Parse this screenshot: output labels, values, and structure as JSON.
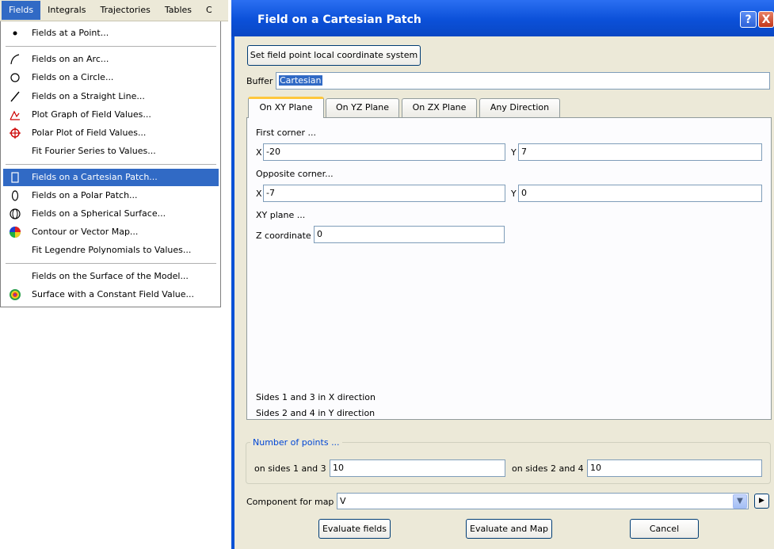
{
  "menubar": {
    "items": [
      "Fields",
      "Integrals",
      "Trajectories",
      "Tables",
      "C"
    ]
  },
  "fields_menu": {
    "items": [
      "Fields at a Point...",
      "Fields on an Arc...",
      "Fields on a Circle...",
      "Fields on a Straight Line...",
      "Plot Graph of Field Values...",
      "Polar Plot of Field Values...",
      "Fit Fourier Series to Values...",
      "Fields on a Cartesian Patch...",
      "Fields on a Polar Patch...",
      "Fields on a Spherical Surface...",
      "Contour or Vector Map...",
      "Fit Legendre Polynomials to Values...",
      "Fields on the Surface of the Model...",
      "Surface with a Constant Field Value..."
    ],
    "highlighted": "Fields on a Cartesian Patch...",
    "icons": [
      "bullet-icon",
      "arc-icon",
      "circle-icon",
      "line-icon",
      "plot-graph-icon",
      "polar-plot-icon",
      "",
      "cartesian-patch-icon",
      "polar-patch-icon",
      "spherical-surface-icon",
      "contour-map-icon",
      "",
      "",
      "constant-surface-icon"
    ]
  },
  "dialog": {
    "title": "Field on a Cartesian Patch",
    "help_button": "?",
    "close_button": "X",
    "set_coord_button": "Set field point local coordinate system",
    "buffer_label": "Buffer",
    "buffer_value": "Cartesian",
    "tabs": [
      "On XY Plane",
      "On YZ Plane",
      "On ZX Plane",
      "Any Direction"
    ],
    "active_tab": "On XY Plane",
    "panel": {
      "first_corner_label": "First corner ...",
      "first_x_label": "X",
      "first_x_value": "-20",
      "first_y_label": "Y",
      "first_y_value": "7",
      "opposite_corner_label": "Opposite corner...",
      "opp_x_label": "X",
      "opp_x_value": "-7",
      "opp_y_label": "Y",
      "opp_y_value": "0",
      "plane_label": "XY plane ...",
      "z_label": "Z coordinate",
      "z_value": "0",
      "note1": "Sides 1 and 3 in X direction",
      "note2": "Sides 2 and 4 in Y direction"
    },
    "points_group": {
      "title": "Number of points ...",
      "sides13_label": "on sides 1 and 3",
      "sides13_value": "10",
      "sides24_label": "on sides 2 and 4",
      "sides24_value": "10"
    },
    "component_label": "Component for map",
    "component_value": "V",
    "buttons": {
      "evaluate_fields": "Evaluate fields",
      "evaluate_and_map": "Evaluate and Map",
      "cancel": "Cancel"
    },
    "colors": {
      "titlebar": "#0a52d6",
      "client": "#ece9d8",
      "selection": "#316ac5",
      "tab_accent": "#ffc73c"
    }
  }
}
